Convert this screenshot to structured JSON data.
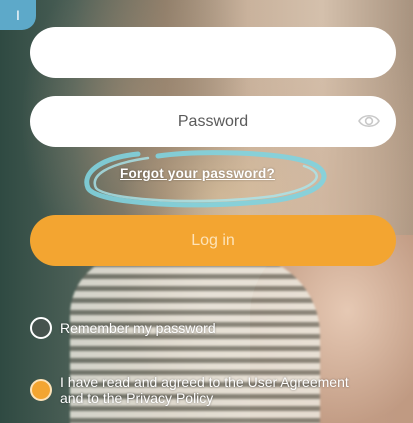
{
  "badge": {
    "text": "I"
  },
  "account_field": {
    "value": "",
    "placeholder": ""
  },
  "password_field": {
    "value": "",
    "placeholder": "Password"
  },
  "forgot_link": {
    "text": "Forgot your password?"
  },
  "login_button": {
    "label": "Log in"
  },
  "remember": {
    "label": "Remember my password",
    "checked": false
  },
  "agreement": {
    "label": "I have read and agreed to the User Agreement and to the Privacy Policy",
    "checked": true
  },
  "colors": {
    "accent": "#f3a531",
    "field_bg": "#ffffff",
    "highlight_scribble": "#7fd3df",
    "badge": "#5da9c9"
  },
  "icons": {
    "password_visibility": "eye-icon"
  }
}
